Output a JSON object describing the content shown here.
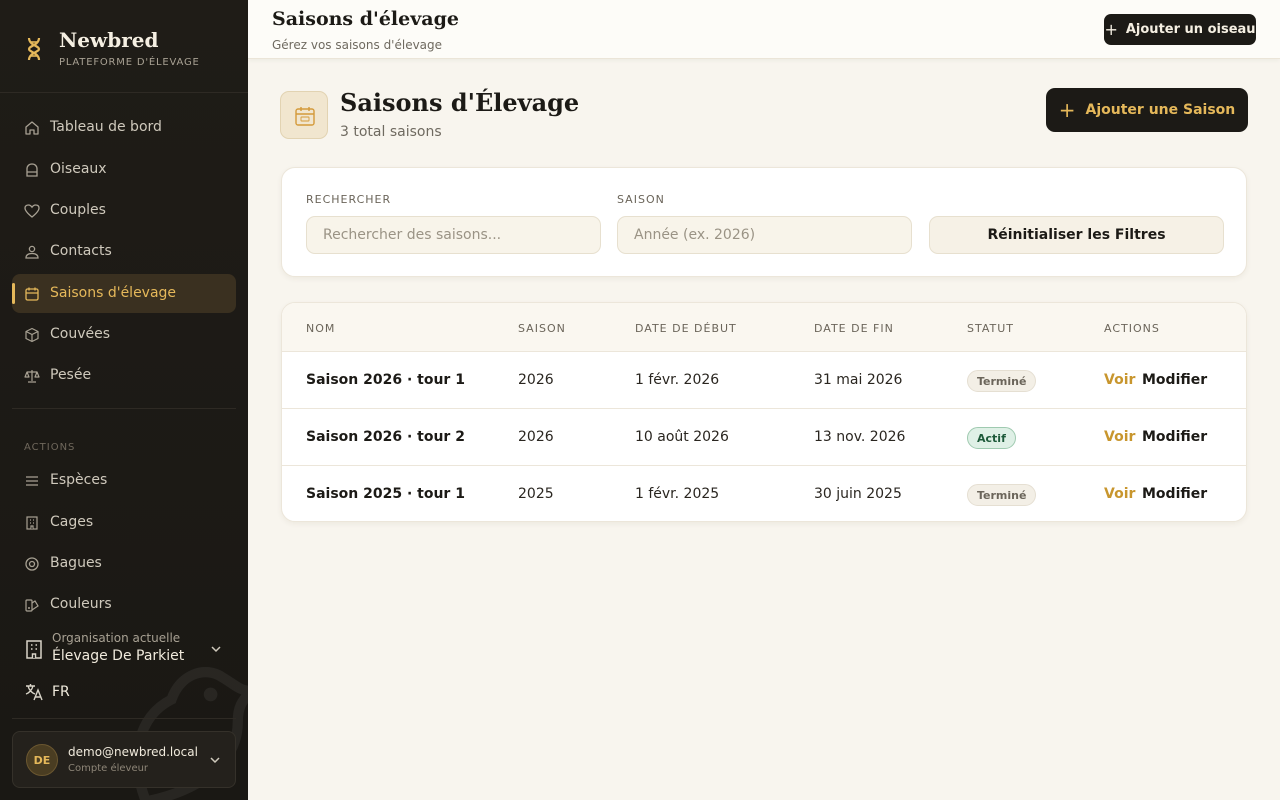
{
  "brand": {
    "name": "Newbred",
    "subtitle": "PLATEFORME D'ÉLEVAGE"
  },
  "sidebar": {
    "nav": [
      {
        "label": "Tableau de bord",
        "icon": "home-icon"
      },
      {
        "label": "Oiseaux",
        "icon": "bird-cage-icon"
      },
      {
        "label": "Couples",
        "icon": "heart-icon"
      },
      {
        "label": "Contacts",
        "icon": "contacts-icon"
      },
      {
        "label": "Saisons d'élevage",
        "icon": "calendar-icon",
        "active": true
      },
      {
        "label": "Couvées",
        "icon": "box-icon"
      },
      {
        "label": "Pesée",
        "icon": "scale-icon"
      }
    ],
    "section_label": "ACTIONS",
    "actions": [
      {
        "label": "Espèces",
        "icon": "list-icon"
      },
      {
        "label": "Cages",
        "icon": "building-icon"
      },
      {
        "label": "Bagues",
        "icon": "ring-icon"
      },
      {
        "label": "Couleurs",
        "icon": "palette-icon"
      }
    ],
    "org": {
      "caption": "Organisation actuelle",
      "name": "Élevage De Parkiet"
    },
    "language": "FR",
    "user": {
      "initials": "DE",
      "email": "demo@newbred.local",
      "role": "Compte éleveur"
    }
  },
  "topbar": {
    "title": "Saisons d'élevage",
    "subtitle": "Gérez vos saisons d'élevage",
    "add_bird_label": "Ajouter un oiseau"
  },
  "page": {
    "title": "Saisons d'Élevage",
    "count": "3 total saisons",
    "add_season_label": "Ajouter une Saison"
  },
  "filters": {
    "search_label": "RECHERCHER",
    "search_placeholder": "Rechercher des saisons...",
    "season_label": "SAISON",
    "season_placeholder": "Année (ex. 2026)",
    "reset_label": "Réinitialiser les Filtres"
  },
  "table": {
    "headers": [
      "NOM",
      "SAISON",
      "DATE DE DÉBUT",
      "DATE DE FIN",
      "STATUT",
      "ACTIONS"
    ],
    "rows": [
      {
        "name": "Saison 2026 · tour 1",
        "season": "2026",
        "start": "1 févr. 2026",
        "end": "31 mai 2026",
        "status": "Terminé",
        "view": "Voir",
        "edit": "Modifier"
      },
      {
        "name": "Saison 2026 · tour 2",
        "season": "2026",
        "start": "10 août 2026",
        "end": "13 nov. 2026",
        "status": "Actif",
        "view": "Voir",
        "edit": "Modifier"
      },
      {
        "name": "Saison 2025 · tour 1",
        "season": "2025",
        "start": "1 févr. 2025",
        "end": "30 juin 2025",
        "status": "Terminé",
        "view": "Voir",
        "edit": "Modifier"
      }
    ]
  },
  "colors": {
    "accent": "#e5b85a",
    "sidebar_bg": "#1f1c17",
    "page_bg": "#f8f5ee",
    "active_badge": "#dff0e6"
  }
}
